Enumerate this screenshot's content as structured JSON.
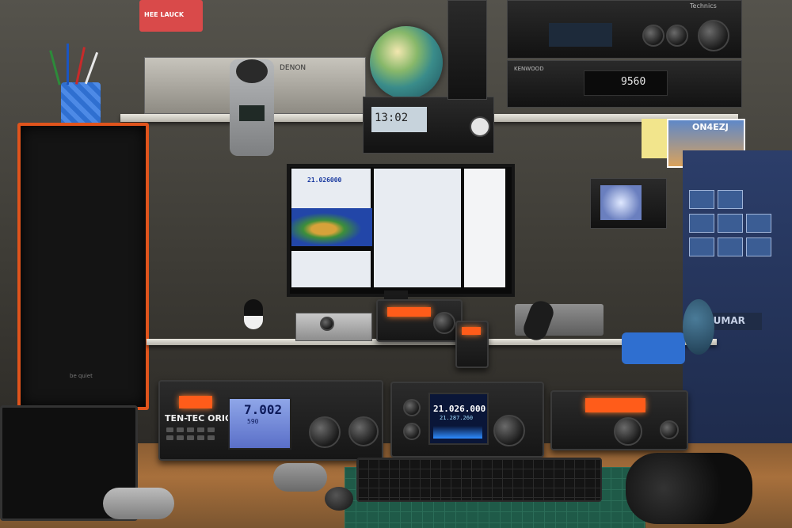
{
  "scene": {
    "description_labels": {
      "sticker_text": "HEE LAUCK",
      "denon_label": "DENON",
      "kenwood_label": "KENWOOD",
      "technics_label": "Technics",
      "tuner_display": "9560",
      "clock_display": "13:02",
      "qsl_card_callsign": "ON4EZJ",
      "orion_brand": "TEN-TEC ORION",
      "orion_frequency": "7.002",
      "orion_sub": "590",
      "icom_frequency_main": "21.026.000",
      "icom_frequency_sub": "21.287.260",
      "monitor_window_value": "21.026000",
      "case_brand": "be quiet",
      "poster_label": "SUMAR"
    },
    "colors": {
      "accent_orange": "#e0541c",
      "lcd_orange": "#ff5c1a",
      "lcd_blue": "#6f86d8",
      "mat_green": "#1f5a48"
    }
  }
}
